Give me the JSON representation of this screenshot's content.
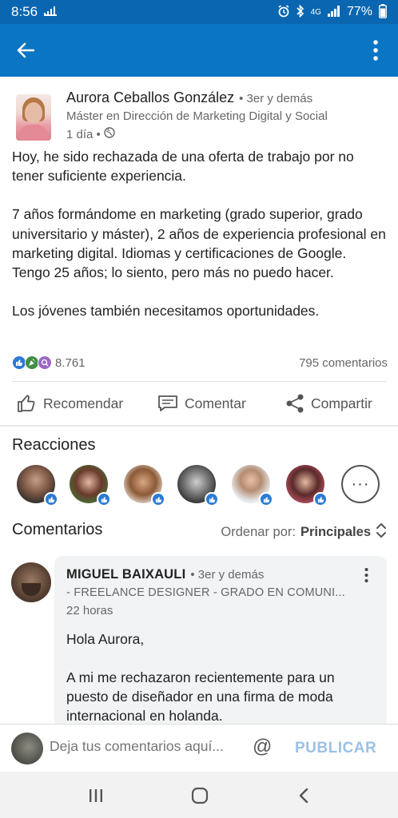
{
  "status_bar": {
    "time": "8:56",
    "left_icon": "signal-activity-icon",
    "network": "4G",
    "battery": "77%"
  },
  "app_bar": {
    "back_icon": "arrow-left-icon",
    "more_icon": "more-vertical-icon"
  },
  "post": {
    "author_name": "Aurora Ceballos González",
    "author_degree": "• 3er y demás",
    "author_headline": "Máster en Dirección de Marketing Digital y Social",
    "time": "1 día •",
    "paragraphs": [
      "Hoy, he sido rechazada de una oferta de trabajo por no tener suficiente experiencia.",
      "7 años formándome en marketing (grado superior, grado universitario y máster), 2 años de experiencia profesional en marketing digital. Idiomas y certificaciones de Google. Tengo 25 años; lo siento, pero más no puedo hacer.",
      "Los jóvenes también necesitamos oportunidades."
    ],
    "reaction_count": "8.761",
    "comments_count": "795 comentarios"
  },
  "actions": {
    "like": "Recomendar",
    "comment": "Comentar",
    "share": "Compartir"
  },
  "reactions": {
    "title": "Reacciones",
    "more_label": "···"
  },
  "comments": {
    "title": "Comentarios",
    "sort_label": "Ordenar por:",
    "sort_value": "Principales",
    "first": {
      "name": "MIGUEL BAIXAULI",
      "degree": "• 3er y demás",
      "headline": "- FREELANCE DESIGNER - GRADO EN COMUNI...",
      "time": "22 horas",
      "greeting": "Hola Aurora,",
      "text": "A mi me rechazaron recientemente para un puesto de diseñador en una firma de moda internacional en holanda."
    }
  },
  "composer": {
    "placeholder": "Deja tus comentarios aquí...",
    "at_symbol": "@",
    "publish": "PUBLICAR"
  },
  "colors": {
    "brand_blue": "#0a75c2",
    "status_blue": "#0a66b0",
    "publish_disabled": "#9bc1e6"
  }
}
